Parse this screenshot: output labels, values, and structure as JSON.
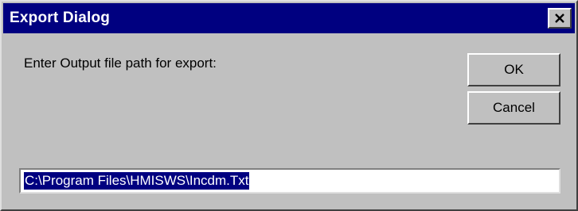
{
  "window": {
    "title": "Export Dialog",
    "close_icon": "close-icon"
  },
  "dialog": {
    "prompt": "Enter Output file path for export:",
    "ok_label": "OK",
    "cancel_label": "Cancel",
    "path_value": "C:\\Program Files\\HMISWS\\Incdm.Txt"
  },
  "colors": {
    "title_bar": "#000080",
    "face": "#c0c0c0",
    "selection": "#000080"
  }
}
